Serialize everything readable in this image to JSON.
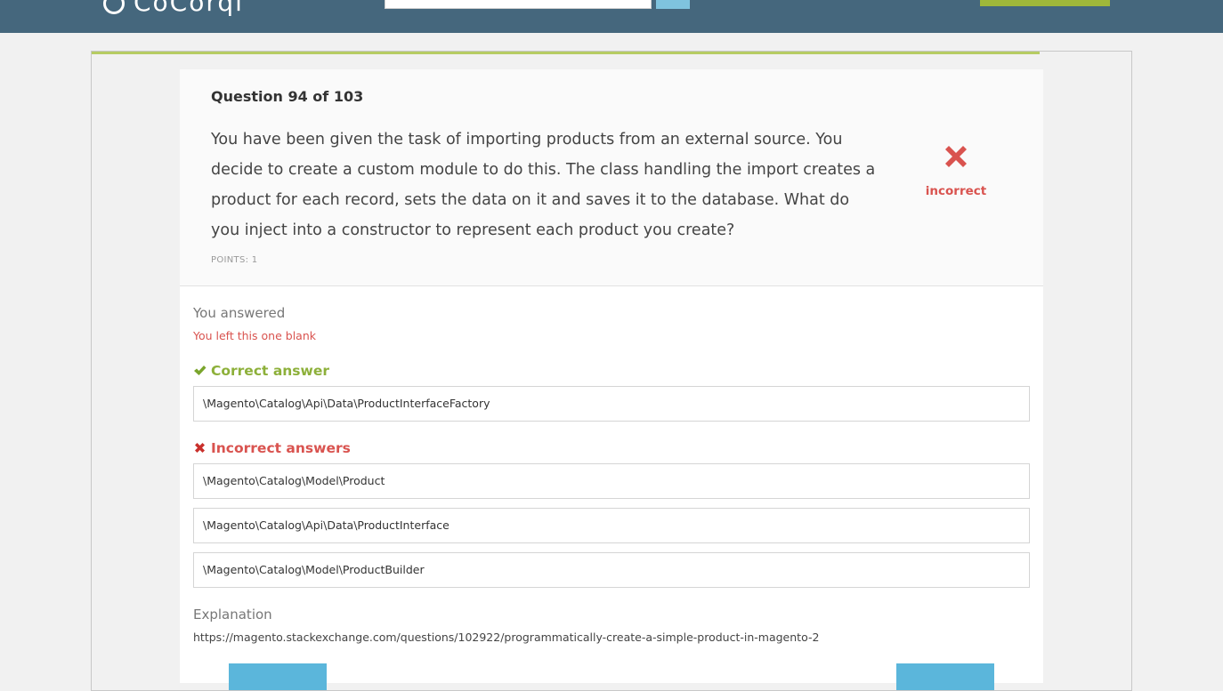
{
  "header": {
    "logo_text": "CoCorqi",
    "search_placeholder": "",
    "search_value": "",
    "search_icon": "search-icon",
    "cta_label": ""
  },
  "question": {
    "counter": "Question 94 of 103",
    "text": "You have been given the task of importing products from an external source. You decide to create a custom module to do this. The class handling the import creates a product for each record, sets the data on it and saves it to the database. What do you inject into a constructor to represent each product you create?",
    "points": "POINTS: 1",
    "result_label": "incorrect",
    "result_icon": "cross-icon"
  },
  "response": {
    "you_answered_label": "You answered",
    "blank_note": "You left this one blank"
  },
  "correct": {
    "heading": "Correct answer",
    "icon": "checkmark-icon",
    "answers": [
      "\\Magento\\Catalog\\Api\\Data\\ProductInterfaceFactory"
    ]
  },
  "incorrect": {
    "heading": "Incorrect answers",
    "icon": "cross-icon",
    "answers": [
      "\\Magento\\Catalog\\Model\\Product",
      "\\Magento\\Catalog\\Api\\Data\\ProductInterface",
      "\\Magento\\Catalog\\Model\\ProductBuilder"
    ]
  },
  "explanation": {
    "label": "Explanation",
    "link": "https://magento.stackexchange.com/questions/102922/programmatically-create-a-simple-product-in-magento-2"
  },
  "colors": {
    "header_bg": "#45677d",
    "correct_green": "#8db03a",
    "incorrect_red": "#d9534f",
    "progress_green": "#b6cc63",
    "button_blue": "#5bb6db"
  }
}
